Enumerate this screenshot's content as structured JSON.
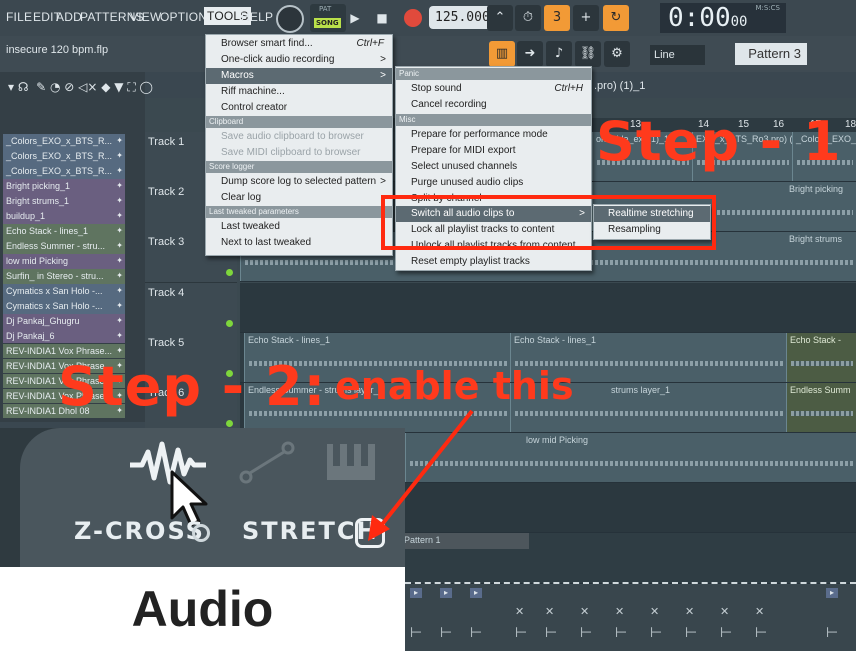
{
  "menubar": {
    "items": [
      "FILE",
      "EDIT",
      "ADD",
      "PATTERNS",
      "VIEW",
      "OPTIONS",
      "TOOLS",
      "HELP"
    ],
    "active": "TOOLS"
  },
  "transport": {
    "mode_top": "PAT",
    "mode_bottom": "SONG",
    "bpm": "125.000",
    "time": "0:00",
    "time_small": "00",
    "time_unit": "M:S:CS"
  },
  "project": {
    "filename": "insecure 120 bpm.flp",
    "pattern_selector": "Pattern 3",
    "snap": "Line",
    "playlist_title": ".pro) (1)_1"
  },
  "channels": [
    {
      "label": "_Colors_EXO_x_BTS_R...",
      "tone": "blue"
    },
    {
      "label": "_Colors_EXO_x_BTS_R...",
      "tone": "blue"
    },
    {
      "label": "_Colors_EXO_x_BTS_R...",
      "tone": "blue"
    },
    {
      "label": "Bright picking_1",
      "tone": "purple"
    },
    {
      "label": "Bright strums_1",
      "tone": "purple"
    },
    {
      "label": "buildup_1",
      "tone": "purple"
    },
    {
      "label": "Echo Stack - lines_1",
      "tone": "green"
    },
    {
      "label": "Endless Summer - stru...",
      "tone": "green"
    },
    {
      "label": "low mid Picking",
      "tone": "purple"
    },
    {
      "label": "Surfin_ in Stereo - stru...",
      "tone": "green"
    },
    {
      "label": "Cymatics x San Holo -...",
      "tone": "blue"
    },
    {
      "label": "Cymatics x San Holo -...",
      "tone": "blue"
    },
    {
      "label": "Dj Pankaj_Ghugru",
      "tone": "purple"
    },
    {
      "label": "Dj Pankaj_6",
      "tone": "purple"
    },
    {
      "label": "REV-INDIA1 Vox Phrase...",
      "tone": "green"
    },
    {
      "label": "REV-INDIA1 Vox Phrase...",
      "tone": "green"
    },
    {
      "label": "REV-INDIA1 Vox Phrase...",
      "tone": "green"
    },
    {
      "label": "REV-INDIA1 Vox Phrase...",
      "tone": "green"
    },
    {
      "label": "REV-INDIA1 Dhol 08",
      "tone": "green"
    }
  ],
  "tracks": [
    "Track 1",
    "Track 2",
    "Track 3",
    "Track 4",
    "Track 5",
    "Track 6"
  ],
  "ruler": [
    "13",
    "14",
    "15",
    "16",
    "17",
    "18"
  ],
  "clips": {
    "t1": [
      "ormable_ext (1)_1",
      "EXO_x_BTS_Ro3.pro) (1)_1",
      "_Colors_EXO_x"
    ],
    "t2": "Bright picking",
    "t3": "Bright strums",
    "t5a": "Echo Stack - lines_1",
    "t5b": "Echo Stack - lines_1",
    "t5c": "Echo Stack -",
    "t6a": "Endless Summer - strums layer_1",
    "t6b": "strums layer_1",
    "t6c": "Endless Summ",
    "t7": "low mid Picking",
    "pattern": "Pattern 1"
  },
  "tools_menu": {
    "items": [
      {
        "label": "Browser smart find...",
        "shortcut": "Ctrl+F"
      },
      {
        "label": "One-click audio recording",
        "arrow": ">"
      },
      {
        "label": "Macros",
        "arrow": ">",
        "highlight": true
      },
      {
        "label": "Riff machine..."
      },
      {
        "label": "Control creator"
      }
    ],
    "section_clipboard": "Clipboard",
    "clipboard_items": [
      "Save audio clipboard to browser",
      "Save MIDI clipboard to browser"
    ],
    "section_score": "Score logger",
    "score_items": [
      "Dump score log to selected pattern",
      "Clear log"
    ],
    "section_tweaked": "Last tweaked parameters",
    "tweaked_items": [
      "Last tweaked",
      "Next to last tweaked"
    ]
  },
  "macros_menu": {
    "section_panic": "Panic",
    "panic_items": [
      {
        "label": "Stop sound",
        "shortcut": "Ctrl+H"
      },
      {
        "label": "Cancel recording"
      }
    ],
    "section_misc": "Misc",
    "misc_items": [
      "Prepare for performance mode",
      "Prepare for MIDI export",
      "Select unused channels",
      "Purge unused audio clips",
      "Split by channel"
    ],
    "switch_item": "Switch all audio clips to",
    "lock_item": "Lock all playlist tracks to content",
    "unlock_item": "Unlock all playlist tracks from content",
    "reset_item": "Reset empty playlist tracks"
  },
  "switch_submenu": {
    "items": [
      "Realtime stretching",
      "Resampling"
    ]
  },
  "overlay": {
    "step1": "Step - 1",
    "step2": "Step - 2:",
    "step2_note": "enable this"
  },
  "inset": {
    "zcross": "Z-CROSS",
    "stretch": "STRETCH",
    "audio": "Audio"
  },
  "colors": {
    "accent_red": "#ff3a1c",
    "menu_bg": "#e9edef",
    "orange": "#f29a36"
  }
}
